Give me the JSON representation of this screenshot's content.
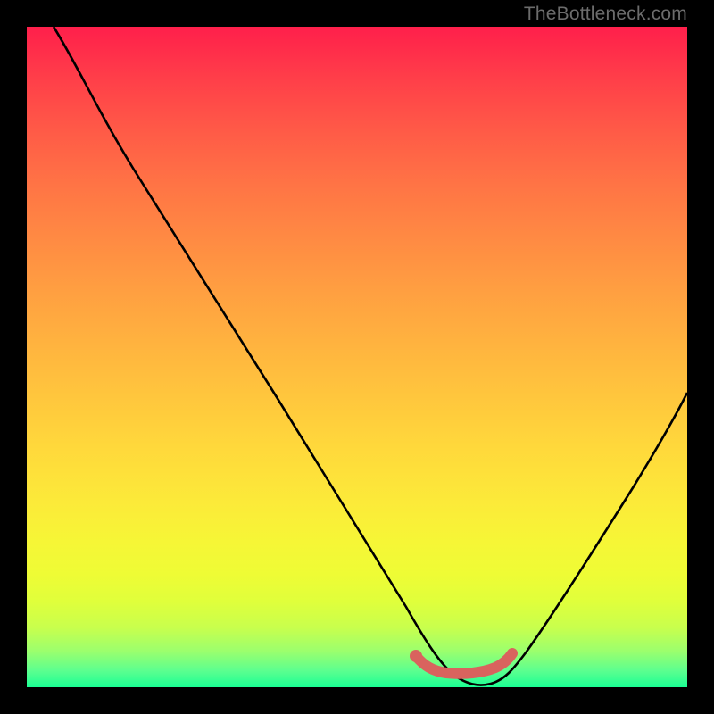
{
  "watermark": "TheBottleneck.com",
  "chart_data": {
    "type": "line",
    "title": "",
    "xlabel": "",
    "ylabel": "",
    "xlim": [
      0,
      100
    ],
    "ylim": [
      0,
      100
    ],
    "grid": false,
    "legend": false,
    "series": [
      {
        "name": "bottleneck-curve",
        "x": [
          4,
          10,
          18,
          28,
          38,
          48,
          55,
          58,
          62,
          66,
          71,
          73,
          80,
          88,
          96,
          100
        ],
        "y": [
          100,
          90,
          78,
          62,
          46,
          30,
          17,
          10,
          4,
          2,
          2,
          4,
          13,
          27,
          42,
          50
        ]
      },
      {
        "name": "optimal-marker",
        "x": [
          59,
          61,
          63,
          65,
          67,
          69,
          71,
          72
        ],
        "y": [
          4.5,
          3.4,
          2.8,
          2.5,
          2.5,
          2.8,
          3.4,
          4.5
        ]
      }
    ],
    "colors": {
      "curve": "#000000",
      "marker": "#d9635e",
      "gradient_top": "#ff1f4b",
      "gradient_bottom": "#1aff94"
    }
  }
}
